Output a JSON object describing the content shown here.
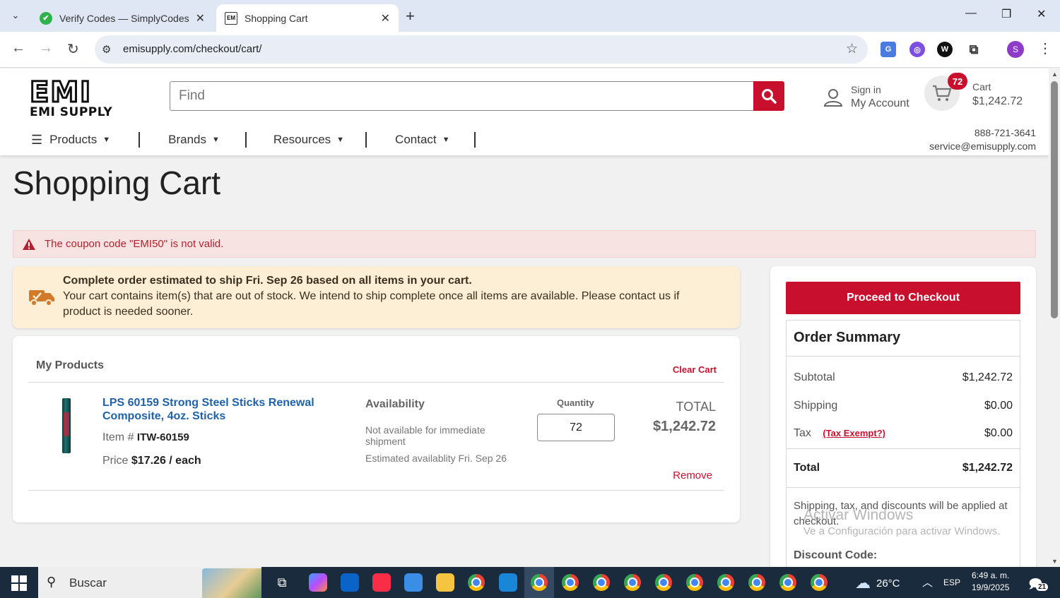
{
  "browser": {
    "tabs": [
      {
        "title": "Verify Codes — SimplyCodes",
        "favicon": "simplycodes-icon"
      },
      {
        "title": "Shopping Cart",
        "favicon": "emi-icon"
      }
    ],
    "url": "emisupply.com/checkout/cart/",
    "profile_initial": "S"
  },
  "header": {
    "logo_big": "EMI",
    "logo_small": "EMI SUPPLY",
    "search_placeholder": "Find",
    "sign_in": "Sign in",
    "my_account": "My Account",
    "cart_count": "72",
    "cart_label": "Cart",
    "cart_total": "$1,242.72",
    "nav": [
      "Products",
      "Brands",
      "Resources",
      "Contact"
    ],
    "phone": "888-721-3641",
    "email": "service@emisupply.com"
  },
  "page": {
    "title": "Shopping Cart",
    "alert": "The coupon code \"EMI50\" is not valid.",
    "ship_bold": "Complete order estimated to ship Fri. Sep 26 based on all items in your cart.",
    "ship_text": "Your cart contains item(s) that are out of stock. We intend to ship complete once all items are available. Please contact us if product is needed sooner."
  },
  "products": {
    "heading": "My Products",
    "clear_cart": "Clear Cart",
    "items": [
      {
        "name": "LPS 60159 Strong Steel Sticks Renewal Composite, 4oz. Sticks",
        "item_label": "Item #",
        "item_no": "ITW-60159",
        "price_label": "Price",
        "price": "$17.26 / each",
        "availability_heading": "Availability",
        "availability_1": "Not available for immediate shipment",
        "availability_2": "Estimated availablity Fri. Sep 26",
        "quantity_label": "Quantity",
        "quantity": "72",
        "total_label": "TOTAL",
        "total": "$1,242.72",
        "remove": "Remove"
      }
    ]
  },
  "summary": {
    "checkout_btn": "Proceed to Checkout",
    "title": "Order Summary",
    "subtotal_label": "Subtotal",
    "subtotal": "$1,242.72",
    "shipping_label": "Shipping",
    "shipping": "$0.00",
    "tax_label": "Tax",
    "tax_exempt": "(Tax Exempt?)",
    "tax": "$0.00",
    "total_label": "Total",
    "total": "$1,242.72",
    "note": "Shipping, tax, and discounts will be applied at checkout.",
    "discount_label": "Discount Code:"
  },
  "watermark": {
    "line1": "Activar Windows",
    "line2": "Ve a Configuración para activar Windows."
  },
  "taskbar": {
    "search": "Buscar",
    "weather": "26°C",
    "lang": "ESP",
    "time": "6:49 a. m.",
    "date": "19/9/2025",
    "notifications": "21"
  },
  "colors": {
    "brand_red": "#c8102e",
    "link_blue": "#1f62a8",
    "notice_bg": "#fcefd5",
    "alert_bg": "#f8e3e3"
  }
}
